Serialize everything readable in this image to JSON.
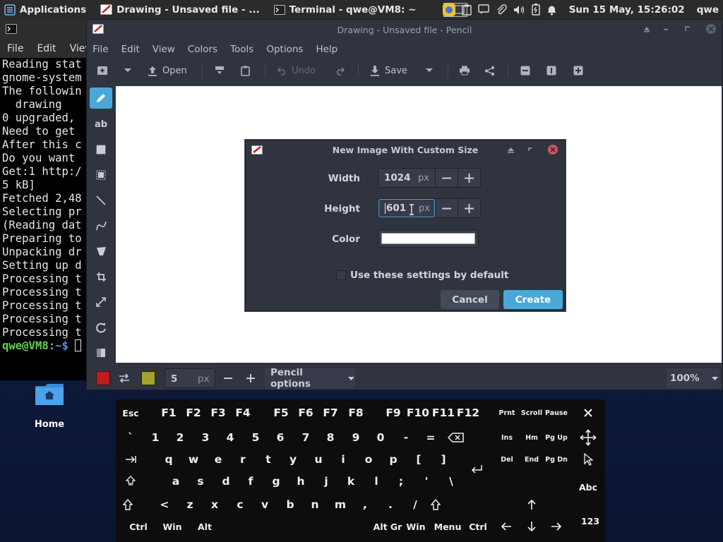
{
  "panel": {
    "applications": "Applications",
    "task_drawing": "Drawing - Unsaved file - ...",
    "task_terminal": "Terminal - qwe@VM8: ~",
    "clock": "Sun 15 May, 15:26:02",
    "user": "qwe"
  },
  "terminal": {
    "menu": [
      "File",
      "Edit",
      "View"
    ],
    "lines": [
      "Reading stat",
      "gnome-system",
      "The followin",
      "  drawing",
      "0 upgraded,",
      "Need to get",
      "After this c",
      "Do you want",
      "Get:1 http:/",
      "5 kB]",
      "Fetched 2,48",
      "Selecting pr",
      "(Reading dat",
      "Preparing to",
      "Unpacking dr",
      "Setting up d",
      "Processing t",
      "Processing t",
      "Processing t",
      "Processing t",
      "Processing t"
    ],
    "prompt_user": "qwe@VM8",
    "prompt_sep": ":",
    "prompt_path": "~$"
  },
  "drawing": {
    "title": "Drawing - Unsaved file - Pencil",
    "menu": {
      "file": "File",
      "edit": "Edit",
      "view": "View",
      "colors": "Colors",
      "tools": "Tools",
      "options": "Options",
      "help": "Help"
    },
    "toolbar": {
      "open": "Open",
      "undo": "Undo",
      "save": "Save"
    },
    "bottom": {
      "size_value": "5",
      "size_unit": "px",
      "tool_options": "Pencil options",
      "zoom": "100%"
    },
    "colors": {
      "primary": "#c01c1c",
      "secondary": "#a5a32b",
      "accent": "#4aa8d8"
    }
  },
  "dialog": {
    "title": "New Image With Custom Size",
    "width_label": "Width",
    "width_value": "1024",
    "height_label": "Height",
    "height_value": "601",
    "unit": "px",
    "color_label": "Color",
    "color_value": "#ffffff",
    "checkbox_label": "Use these settings by default",
    "checkbox_checked": false,
    "cancel": "Cancel",
    "create": "Create"
  },
  "desktop": {
    "home_label": "Home"
  },
  "keyboard": {
    "row1": [
      "Esc",
      "F1",
      "F2",
      "F3",
      "F4",
      "F5",
      "F6",
      "F7",
      "F8",
      "F9",
      "F10",
      "F11",
      "F12",
      "Prnt",
      "Scroll",
      "Pause"
    ],
    "row2": [
      "`",
      "1",
      "2",
      "3",
      "4",
      "5",
      "6",
      "7",
      "8",
      "9",
      "0",
      "-",
      "=",
      "Ins",
      "Hm",
      "Pg Up"
    ],
    "row3": [
      "q",
      "w",
      "e",
      "r",
      "t",
      "y",
      "u",
      "i",
      "o",
      "p",
      "[",
      "]",
      "Del",
      "End",
      "Pg Dn"
    ],
    "row4": [
      "a",
      "s",
      "d",
      "f",
      "g",
      "h",
      "j",
      "k",
      "l",
      ";",
      "'",
      "\\",
      "Abc"
    ],
    "row5": [
      "<",
      "z",
      "x",
      "c",
      "v",
      "b",
      "n",
      "m",
      ",",
      ".",
      "/"
    ],
    "row6": [
      "Ctrl",
      "Win",
      "Alt",
      "Alt Gr",
      "Win",
      "Menu",
      "Ctrl",
      "123"
    ]
  }
}
